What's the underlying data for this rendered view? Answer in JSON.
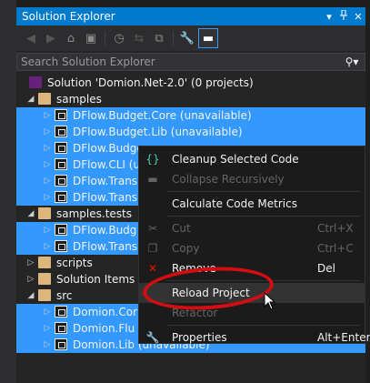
{
  "window": {
    "title": "Solution Explorer",
    "pin_icon": "pin-icon",
    "close_icon": "close-icon",
    "dropdown_icon": "chevron-down-icon"
  },
  "search": {
    "placeholder": "Search Solution Explorer"
  },
  "tree": [
    {
      "kind": "solution",
      "label": "Solution 'Domion.Net-2.0' (0 projects)",
      "indent": 0,
      "selected": false
    },
    {
      "kind": "folder",
      "label": "samples",
      "indent": 1,
      "expanded": true,
      "selected": false
    },
    {
      "kind": "project",
      "label": "DFlow.Budget.Core (unavailable)",
      "indent": 2,
      "selected": true
    },
    {
      "kind": "project",
      "label": "DFlow.Budget.Lib (unavailable)",
      "indent": 2,
      "selected": true
    },
    {
      "kind": "project",
      "label": "DFlow.Budge",
      "indent": 2,
      "selected": true
    },
    {
      "kind": "project",
      "label": "DFlow.CLI (u",
      "indent": 2,
      "selected": true
    },
    {
      "kind": "project",
      "label": "DFlow.Trans",
      "indent": 2,
      "selected": true
    },
    {
      "kind": "project",
      "label": "DFlow.Trans",
      "indent": 2,
      "selected": true
    },
    {
      "kind": "folder",
      "label": "samples.tests",
      "indent": 1,
      "expanded": true,
      "selected": false
    },
    {
      "kind": "project",
      "label": "DFlow.Budg",
      "indent": 2,
      "selected": true
    },
    {
      "kind": "project",
      "label": "DFlow.Trans",
      "indent": 2,
      "selected": true
    },
    {
      "kind": "folder",
      "label": "scripts",
      "indent": 1,
      "expanded": false,
      "selected": false
    },
    {
      "kind": "folder",
      "label": "Solution Items",
      "indent": 1,
      "expanded": false,
      "selected": false
    },
    {
      "kind": "folder",
      "label": "src",
      "indent": 1,
      "expanded": true,
      "selected": false
    },
    {
      "kind": "project",
      "label": "Domion.Cor",
      "indent": 2,
      "selected": true
    },
    {
      "kind": "project",
      "label": "Domion.Flu",
      "indent": 2,
      "selected": true
    },
    {
      "kind": "project",
      "label": "Domion.Lib (unavailable)",
      "indent": 2,
      "selected": true
    }
  ],
  "context_menu": {
    "items": [
      {
        "label": "Cleanup Selected Code",
        "shortcut": "",
        "icon": "braces-icon",
        "disabled": false
      },
      {
        "label": "Collapse Recursively",
        "shortcut": "",
        "icon": "minus-icon",
        "disabled": true
      },
      {
        "sep": true
      },
      {
        "label": "Calculate Code Metrics",
        "shortcut": "",
        "icon": "",
        "disabled": false
      },
      {
        "sep": true
      },
      {
        "label": "Cut",
        "shortcut": "Ctrl+X",
        "icon": "scissors-icon",
        "disabled": true
      },
      {
        "label": "Copy",
        "shortcut": "Ctrl+C",
        "icon": "copy-icon",
        "disabled": true
      },
      {
        "label": "Remove",
        "shortcut": "Del",
        "icon": "remove-icon",
        "disabled": false
      },
      {
        "sep": true
      },
      {
        "label": "Reload Project",
        "shortcut": "",
        "icon": "",
        "disabled": false,
        "hover": true
      },
      {
        "label": "Refactor",
        "shortcut": "",
        "icon": "",
        "disabled": true
      },
      {
        "sep": true
      },
      {
        "label": "Properties",
        "shortcut": "Alt+Enter",
        "icon": "wrench-icon",
        "disabled": false
      }
    ]
  },
  "colors": {
    "accent": "#007acc",
    "selection": "#3399ff",
    "highlight_ring": "#d40d12",
    "background": "#252526"
  }
}
